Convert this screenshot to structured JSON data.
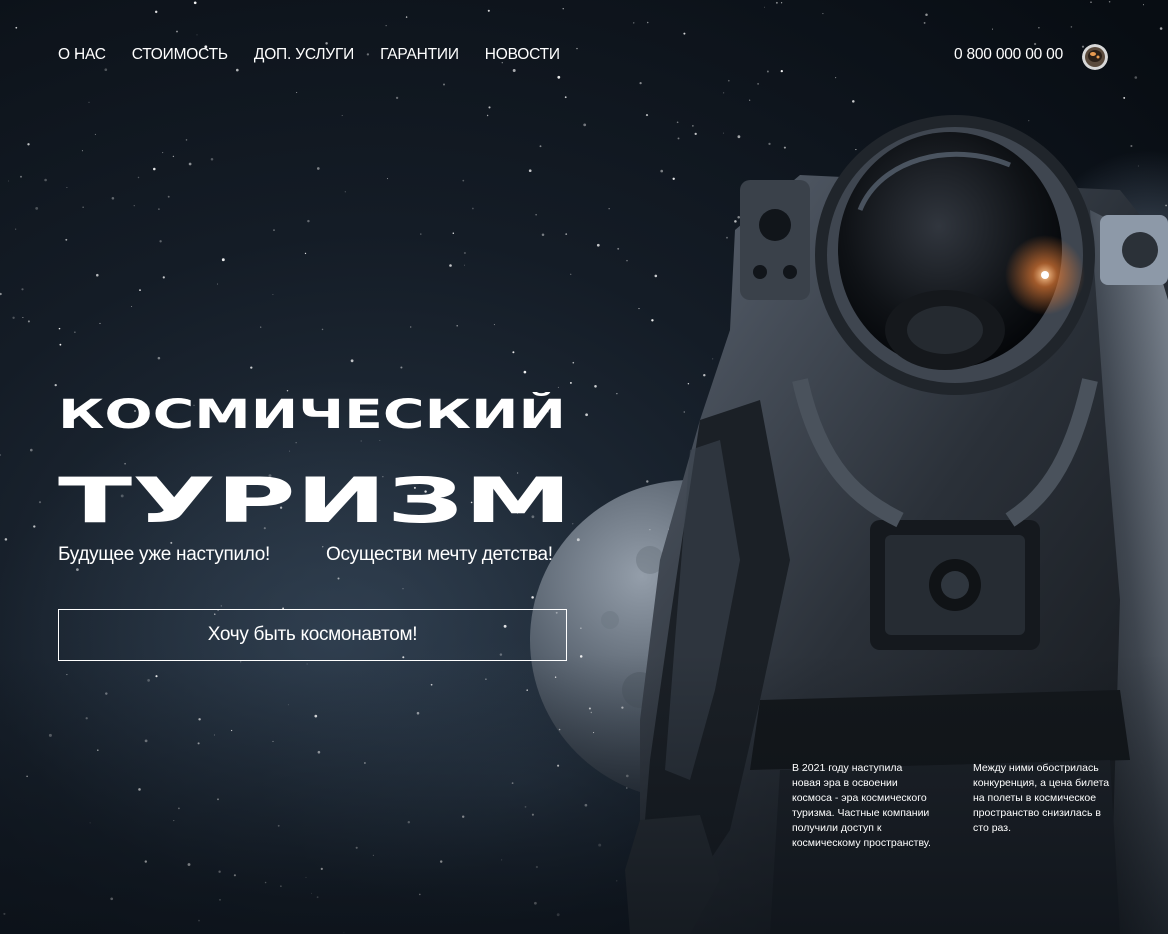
{
  "nav": {
    "items": [
      {
        "label": "О НАС"
      },
      {
        "label": "СТОИМОСТЬ"
      },
      {
        "label": "ДОП. УСЛУГИ"
      },
      {
        "label": "ГАРАНТИИ"
      },
      {
        "label": "НОВОСТИ"
      }
    ],
    "phone": "0 800 000 00 00"
  },
  "hero": {
    "title_line1": "КОСМИЧЕСКИЙ",
    "title_line2": "ТУРИЗМ",
    "subtitle_left": "Будущее уже наступило!",
    "subtitle_right": "Осуществи мечту детства!",
    "cta_label": "Хочу быть космонавтом!"
  },
  "info": {
    "block1": "В 2021 году наступила новая эра в освоении космоса - эра космического туризма. Частные компании получили доступ к космическому пространству.",
    "block2": "Между ними обострилась конкуренция, а цена билета на полеты в космическое пространство снизилась в сто раз."
  },
  "colors": {
    "background": "#0b1118",
    "text": "#ffffff"
  },
  "icons": {
    "avatar": "astronaut-helmet-avatar"
  }
}
